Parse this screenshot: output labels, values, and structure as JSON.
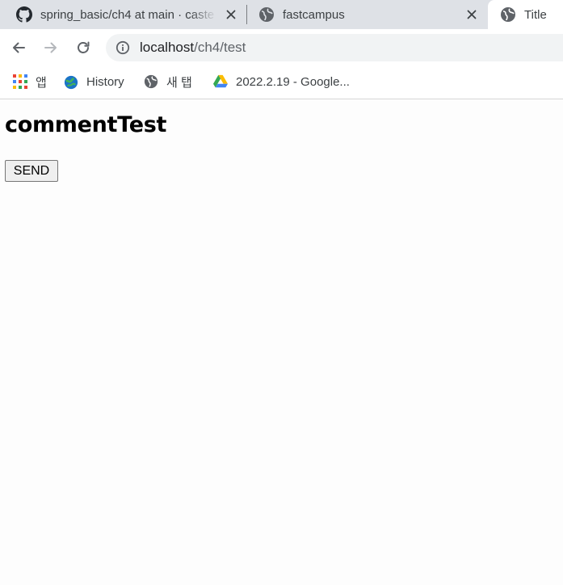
{
  "tabs": [
    {
      "title": "spring_basic/ch4 at main · caste",
      "icon": "github-icon",
      "active": false
    },
    {
      "title": "fastcampus",
      "icon": "globe-icon",
      "active": false
    },
    {
      "title": "Title",
      "icon": "globe-icon",
      "active": true
    }
  ],
  "address_bar": {
    "host": "localhost",
    "path": "/ch4/test"
  },
  "bookmarks": [
    {
      "label": "앱",
      "icon": "apps-grid-icon"
    },
    {
      "label": "History",
      "icon": "edge-globe-icon"
    },
    {
      "label": "새 탭",
      "icon": "globe-icon"
    },
    {
      "label": "2022.2.19 - Google...",
      "icon": "google-drive-icon"
    }
  ],
  "page": {
    "heading": "commentTest",
    "send_button": "SEND"
  },
  "colors": {
    "tabstrip_bg": "#dee1e6",
    "omnibox_bg": "#f1f3f4",
    "page_bg": "#fdfdfd"
  }
}
